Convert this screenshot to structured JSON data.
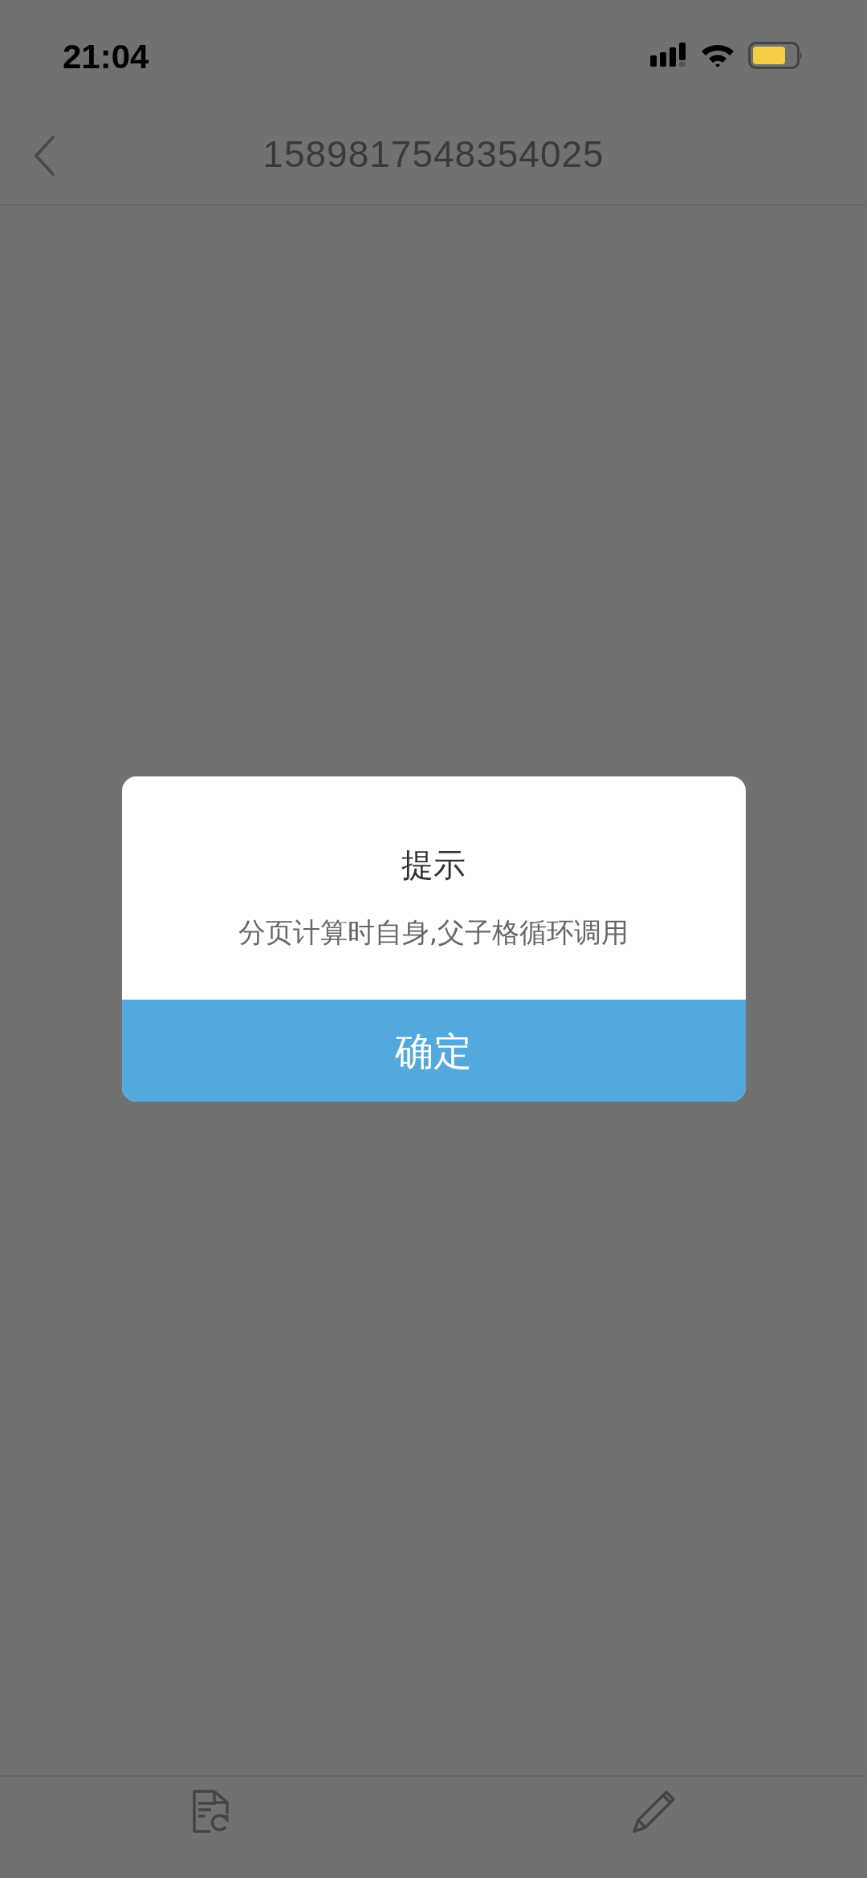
{
  "status_bar": {
    "time": "21:04"
  },
  "nav_bar": {
    "title": "1589817548354025"
  },
  "dialog": {
    "title": "提示",
    "message": "分页计算时自身,父子格循环调用",
    "button": "确定"
  }
}
